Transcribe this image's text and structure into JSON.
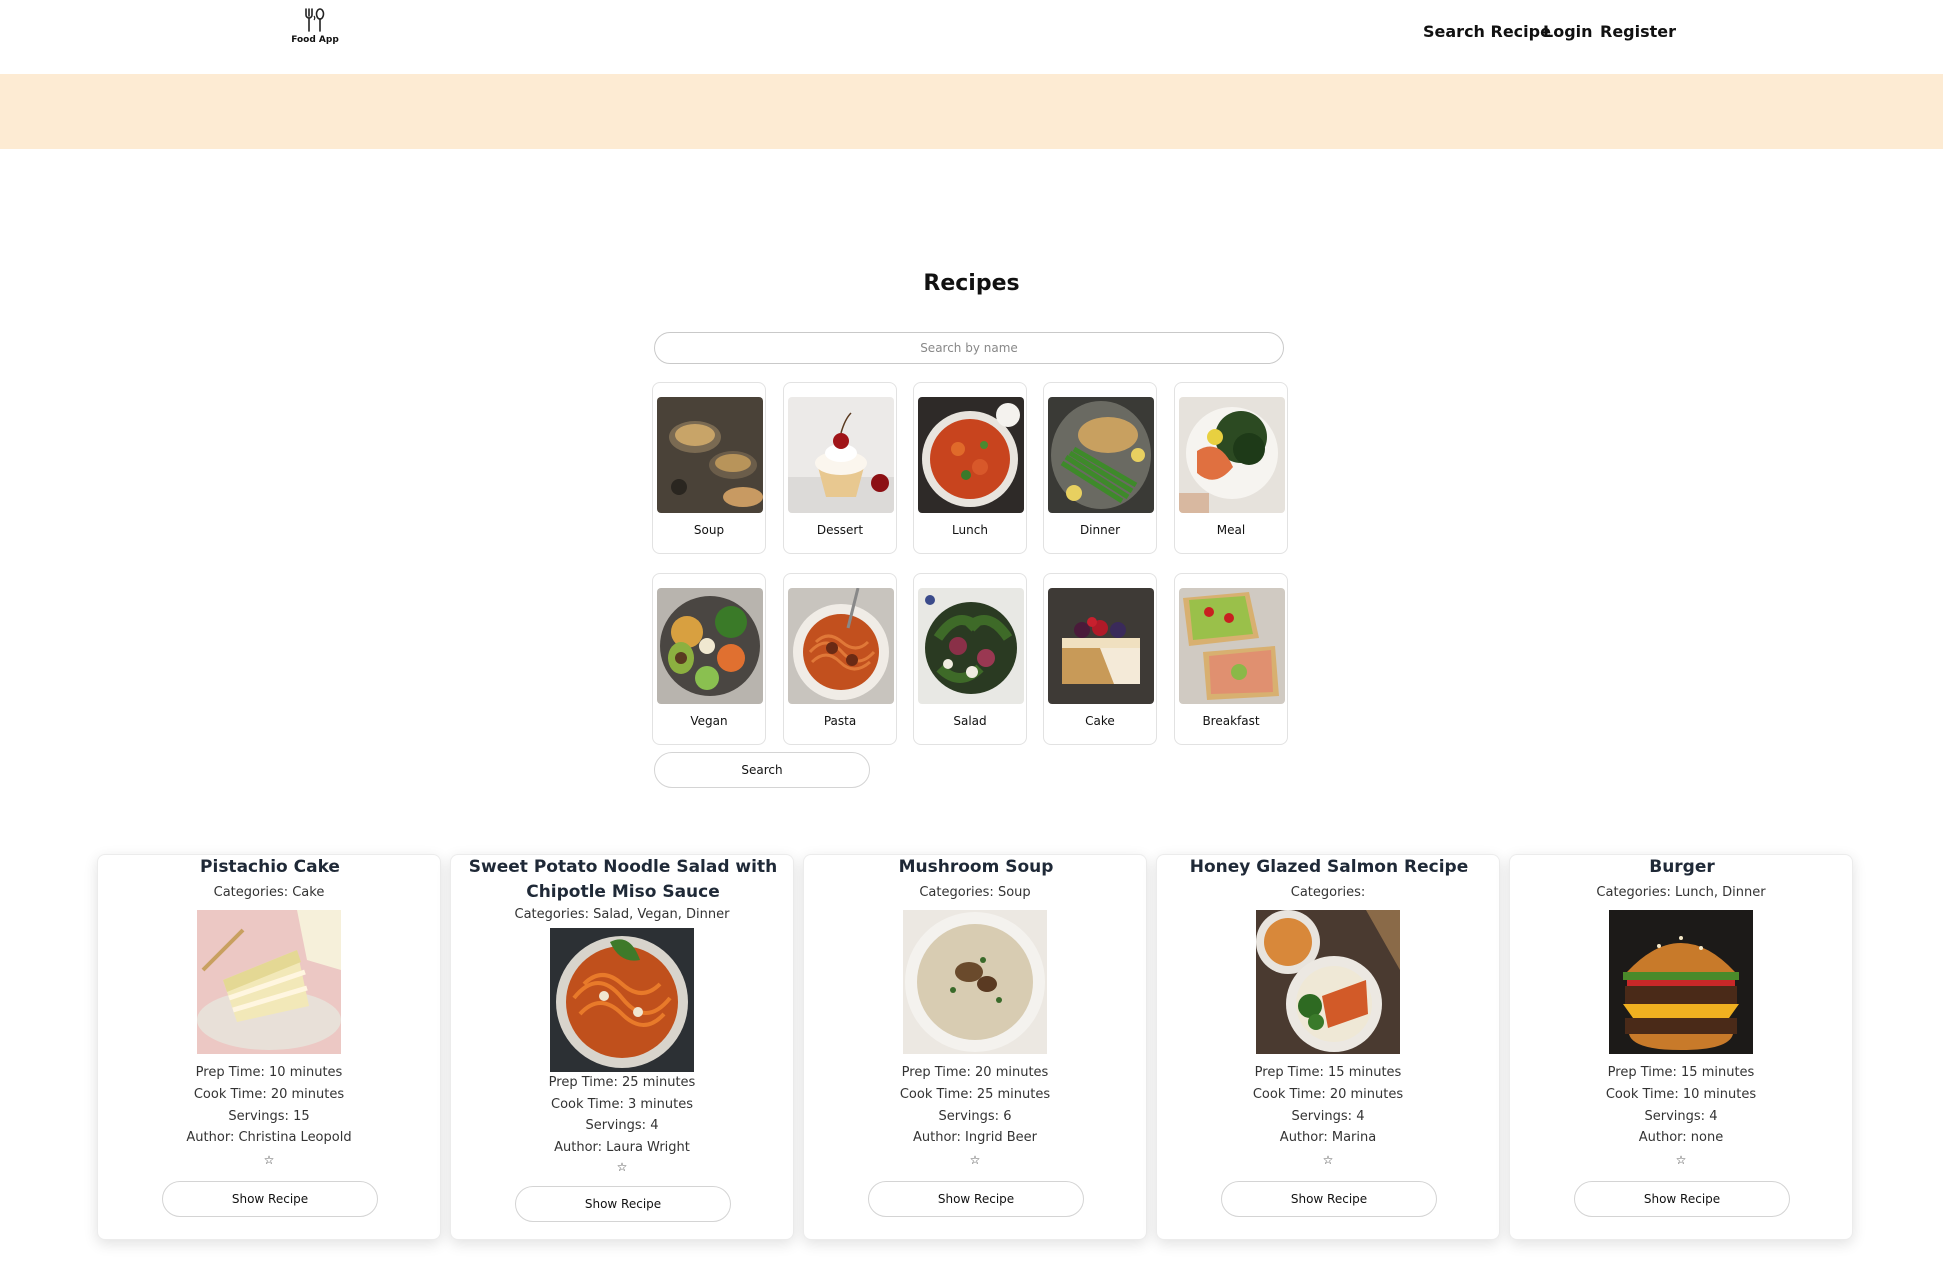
{
  "header": {
    "logo_text": "Food App",
    "nav": [
      "Search Recipe",
      "Login",
      "Register"
    ]
  },
  "main": {
    "title": "Recipes",
    "search_placeholder": "Search by name",
    "search_button": "Search",
    "categories": [
      "Soup",
      "Dessert",
      "Lunch",
      "Dinner",
      "Meal",
      "Vegan",
      "Pasta",
      "Salad",
      "Cake",
      "Breakfast"
    ]
  },
  "recipes": [
    {
      "title": "Pistachio Cake",
      "categories": "Categories: Cake",
      "prep": "Prep Time: 10 minutes",
      "cook": "Cook Time: 20 minutes",
      "servings": "Servings: 15",
      "author": "Author: Christina Leopold",
      "star": "☆",
      "button": "Show Recipe"
    },
    {
      "title": "Sweet Potato Noodle Salad with Chipotle Miso Sauce",
      "categories": "Categories: Salad, Vegan, Dinner",
      "prep": "Prep Time: 25 minutes",
      "cook": "Cook Time: 3 minutes",
      "servings": "Servings: 4",
      "author": "Author: Laura Wright",
      "star": "☆",
      "button": "Show Recipe"
    },
    {
      "title": "Mushroom Soup",
      "categories": "Categories: Soup",
      "prep": "Prep Time: 20 minutes",
      "cook": "Cook Time: 25 minutes",
      "servings": "Servings: 6",
      "author": "Author: Ingrid Beer",
      "star": "☆",
      "button": "Show Recipe"
    },
    {
      "title": "Honey Glazed Salmon Recipe",
      "categories": "Categories:",
      "prep": "Prep Time: 15 minutes",
      "cook": "Cook Time: 20 minutes",
      "servings": "Servings: 4",
      "author": "Author: Marina",
      "star": "☆",
      "button": "Show Recipe"
    },
    {
      "title": "Burger",
      "categories": "Categories: Lunch, Dinner",
      "prep": "Prep Time: 15 minutes",
      "cook": "Cook Time: 10 minutes",
      "servings": "Servings: 4",
      "author": "Author: none",
      "star": "☆",
      "button": "Show Recipe"
    }
  ]
}
